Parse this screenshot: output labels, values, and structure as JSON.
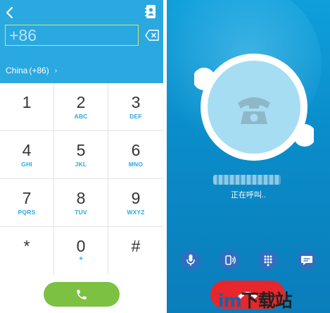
{
  "dialer": {
    "number_placeholder": "+86",
    "number_value": "",
    "country_name": "China",
    "country_code": "(+86)",
    "country_chevron": "›",
    "keys": [
      {
        "digit": "1",
        "letters": ""
      },
      {
        "digit": "2",
        "letters": "ABC"
      },
      {
        "digit": "3",
        "letters": "DEF"
      },
      {
        "digit": "4",
        "letters": "GHI"
      },
      {
        "digit": "5",
        "letters": "JKL"
      },
      {
        "digit": "6",
        "letters": "MNO"
      },
      {
        "digit": "7",
        "letters": "PQRS"
      },
      {
        "digit": "8",
        "letters": "TUV"
      },
      {
        "digit": "9",
        "letters": "WXYZ"
      },
      {
        "digit": "*",
        "letters": ""
      },
      {
        "digit": "0",
        "letters": "+"
      },
      {
        "digit": "#",
        "letters": ""
      }
    ],
    "icons": {
      "back": "back-chevron-icon",
      "contacts": "contacts-book-icon",
      "backspace": "backspace-icon",
      "call": "phone-icon"
    }
  },
  "calling": {
    "contact_name_blurred": "•••••••••••••••",
    "status": "正在呼叫..",
    "controls": [
      "microphone-icon",
      "speaker-icon",
      "dialpad-icon",
      "chat-icon"
    ],
    "hangup_icon": "hang-up-icon"
  },
  "watermark": {
    "prefix": "im",
    "text": "下载站"
  },
  "colors": {
    "accent_blue": "#2aa8e0",
    "call_green": "#7cc142",
    "hangup_red": "#e8262c",
    "calling_bg": "#0a8cc9",
    "control_blue": "#2f6fc0"
  }
}
